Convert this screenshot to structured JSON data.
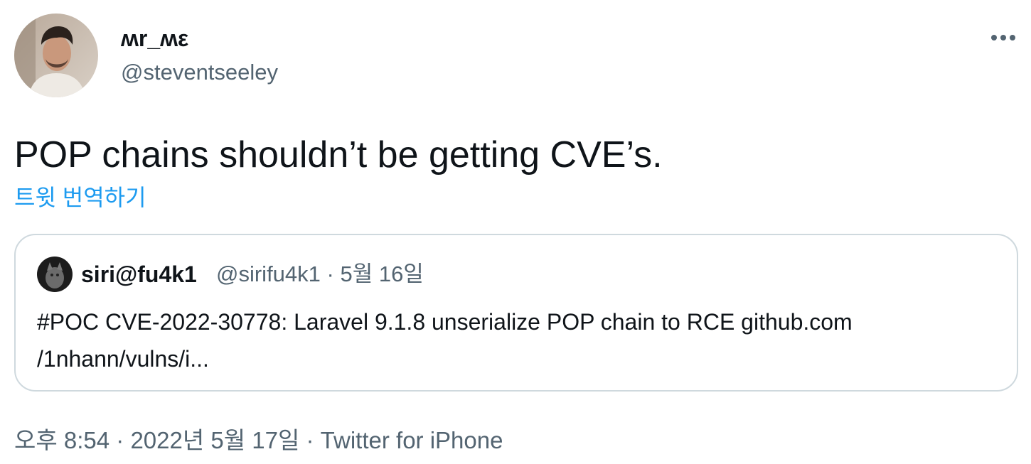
{
  "author": {
    "display_name": "ʍr_ʍε",
    "handle": "@steventseeley"
  },
  "tweet": {
    "text": "POP chains shouldn’t be getting CVE’s.",
    "translate_label": "트윗 번역하기",
    "timestamp": "오후 8:54 · 2022년 5월 17일",
    "separator": " · ",
    "source": "Twitter for iPhone"
  },
  "quoted_tweet": {
    "display_name": "siri@fu4k1",
    "meta": "@sirifu4k1 · 5월 16일",
    "text_line1": "#POC CVE-2022-30778: Laravel 9.1.8 unserialize POP chain to RCE  github.com",
    "text_line2": "/1nhann/vulns/i..."
  },
  "icons": {
    "more": "more-horizontal-icon"
  },
  "colors": {
    "text_primary": "#0f1419",
    "text_secondary": "#536471",
    "link": "#1d9bf0",
    "border": "#cfd9de"
  }
}
